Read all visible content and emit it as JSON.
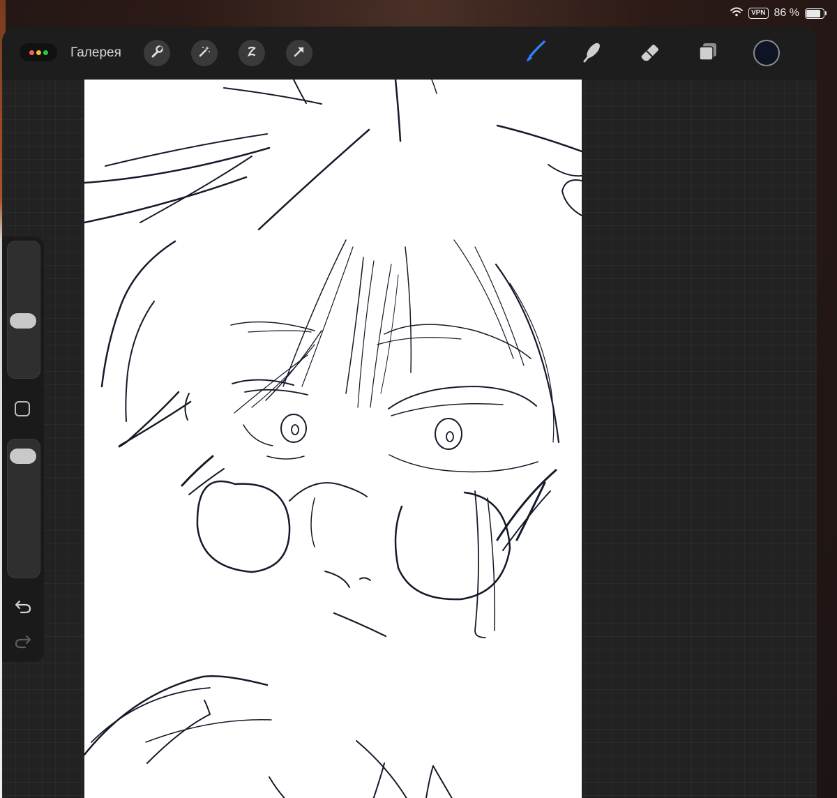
{
  "status_bar": {
    "vpn": "VPN",
    "battery": "86 %",
    "battery_level": 0.86
  },
  "toolbar": {
    "gallery_label": "Галерея",
    "left_tools": [
      "wrench-icon",
      "magic-wand-icon",
      "selection-icon",
      "transform-arrow-icon"
    ],
    "right_tools": [
      "brush-icon",
      "smudge-icon",
      "eraser-icon",
      "layers-icon"
    ],
    "active_tool": "brush",
    "current_color": "#0f1424"
  },
  "sidebar": {
    "brush_size_level": 0.4,
    "opacity_level": 0.95
  },
  "colors": {
    "accent": "#2f7ff7",
    "canvas": "#ffffff",
    "ink": "#151a2a"
  }
}
